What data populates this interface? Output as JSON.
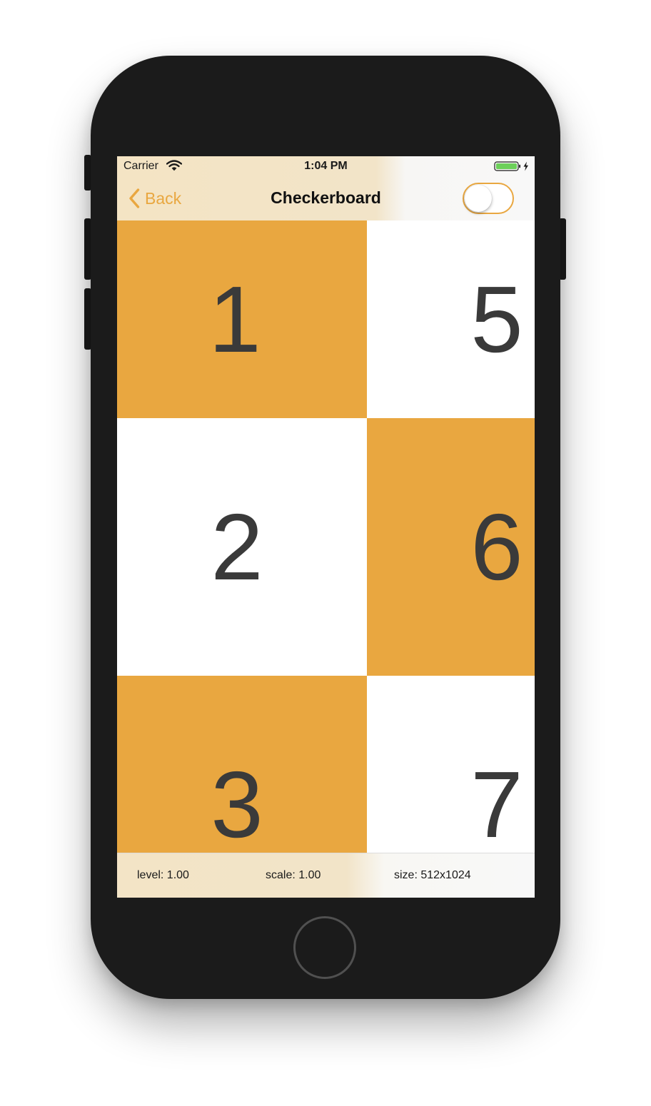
{
  "status_bar": {
    "carrier": "Carrier",
    "time": "1:04 PM",
    "wifi_icon": "wifi-icon",
    "battery_icon": "battery-charging-icon",
    "battery_color": "#6cd05a"
  },
  "nav_bar": {
    "back_label": "Back",
    "back_icon": "chevron-left-icon",
    "title": "Checkerboard",
    "toggle_on": false
  },
  "colors": {
    "accent": "#e9a740",
    "tile_orange": "#e9a740",
    "tile_white": "#ffffff",
    "digit": "#3a3a3a"
  },
  "board": {
    "tiles": [
      {
        "label": "1",
        "color": "orange"
      },
      {
        "label": "5",
        "color": "white"
      },
      {
        "label": "2",
        "color": "white"
      },
      {
        "label": "6",
        "color": "orange"
      },
      {
        "label": "3",
        "color": "orange"
      },
      {
        "label": "7",
        "color": "white"
      }
    ]
  },
  "info_bar": {
    "level": "level: 1.00",
    "scale": "scale: 1.00",
    "size": "size: 512x1024"
  }
}
